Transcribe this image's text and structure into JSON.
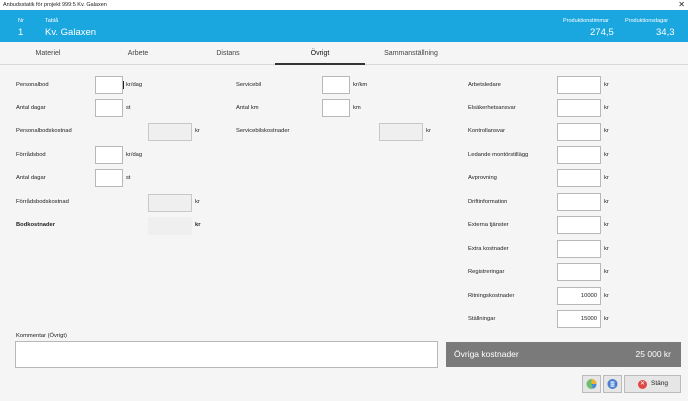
{
  "window": {
    "title": "Anbudsstatik för projekt 999:5 Kv. Galaxen",
    "close_glyph": "✕"
  },
  "header": {
    "nr_label": "Nr",
    "nr_value": "1",
    "table_label": "Tablå",
    "table_value": "Kv. Galaxen",
    "prod_hours_label": "Produktionstimmar",
    "prod_hours_value": "274,5",
    "prod_days_label": "Produktionsdagar",
    "prod_days_value": "34,3"
  },
  "tabs": [
    {
      "label": "Materiel"
    },
    {
      "label": "Arbete"
    },
    {
      "label": "Distans"
    },
    {
      "label": "Övrigt"
    },
    {
      "label": "Sammanställning"
    }
  ],
  "col1": [
    {
      "label": "Personalbod",
      "value": "",
      "unit": "kr/dag"
    },
    {
      "label": "Antal dagar",
      "value": "",
      "unit": "st"
    },
    {
      "label": "Personalbodskostnad",
      "value": "",
      "unit": "kr"
    },
    {
      "label": "Förrådsbod",
      "value": "",
      "unit": "kr/dag"
    },
    {
      "label": "Antal dagar",
      "value": "",
      "unit": "st"
    },
    {
      "label": "Förrådsbodskostnad",
      "value": "",
      "unit": "kr"
    },
    {
      "label": "Bodkostnader",
      "value": "",
      "unit": "kr"
    }
  ],
  "col2": [
    {
      "label": "Servicebil",
      "value": "",
      "unit": "kr/km"
    },
    {
      "label": "Antal km",
      "value": "",
      "unit": "km"
    },
    {
      "label": "Servicebilskostnader",
      "value": "",
      "unit": "kr"
    }
  ],
  "col3": [
    {
      "label": "Arbetsledare",
      "value": "",
      "unit": "kr"
    },
    {
      "label": "Elsäkerhetsansvar",
      "value": "",
      "unit": "kr"
    },
    {
      "label": "Kontrollansvar",
      "value": "",
      "unit": "kr"
    },
    {
      "label": "Ledande montörstillägg",
      "value": "",
      "unit": "kr"
    },
    {
      "label": "Avprovning",
      "value": "",
      "unit": "kr"
    },
    {
      "label": "Driftinformation",
      "value": "",
      "unit": "kr"
    },
    {
      "label": "Externa tjänster",
      "value": "",
      "unit": "kr"
    },
    {
      "label": "Extra kostnader",
      "value": "",
      "unit": "kr"
    },
    {
      "label": "Registreringar",
      "value": "",
      "unit": "kr"
    },
    {
      "label": "Ritningskostnader",
      "value": "10000",
      "unit": "kr"
    },
    {
      "label": "Ställningar",
      "value": "15000",
      "unit": "kr"
    }
  ],
  "comment": {
    "label": "Kommentar (Övrigt)",
    "value": ""
  },
  "summary": {
    "label": "Övriga kostnader",
    "value": "25 000 kr"
  },
  "buttons": {
    "close_label": "Stäng",
    "chart_icon": "pie-chart-icon",
    "calc_icon": "calculator-icon",
    "close_icon": "close-circle-icon"
  },
  "colors": {
    "header": "#1aa6df",
    "summary_bg": "#7a7a7a",
    "close_red": "#e04848"
  }
}
